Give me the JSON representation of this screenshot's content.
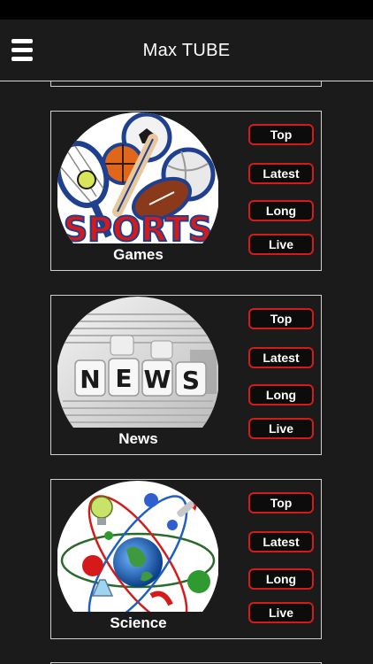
{
  "header": {
    "title": "Max TUBE",
    "menu_icon": "hamburger-menu-icon"
  },
  "categories": [
    {
      "label": "Games",
      "image": "sports-equipment-image",
      "thumb_text": "SPORTS",
      "buttons": [
        "Top",
        "Latest",
        "Long",
        "Live"
      ]
    },
    {
      "label": "News",
      "image": "news-dice-newspaper-image",
      "thumb_text": "NEWS",
      "buttons": [
        "Top",
        "Latest",
        "Long",
        "Live"
      ]
    },
    {
      "label": "Science",
      "image": "science-globe-atom-image",
      "buttons": [
        "Top",
        "Latest",
        "Long",
        "Live"
      ]
    }
  ],
  "colors": {
    "background": "#1b1b1b",
    "button_border": "#d61a1a",
    "text": "#ffffff"
  }
}
